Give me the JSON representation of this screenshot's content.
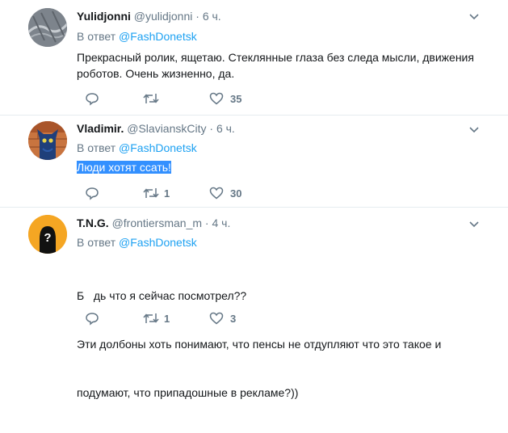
{
  "tweets": [
    {
      "name": "Yulidjonni",
      "handle": "@yulidjonni",
      "separator": "·",
      "time": "6 ч.",
      "reply_prefix": "В ответ",
      "reply_to": "@FashDonetsk",
      "text_lines": [
        "Прекрасный ролик, ящетаю. Стеклянные глаза без следа мысли, движения",
        "роботов. Очень жизненно, да."
      ],
      "retweets": "",
      "likes": "35"
    },
    {
      "name": "Vladimir.",
      "handle": "@SlavianskCity",
      "separator": "·",
      "time": "6 ч.",
      "reply_prefix": "В ответ",
      "reply_to": "@FashDonetsk",
      "text": "Люди хотят ссать!",
      "retweets": "1",
      "likes": "30"
    },
    {
      "name": "T.N.G.",
      "handle": "@frontiersman_m",
      "separator": "·",
      "time": "4 ч.",
      "reply_prefix": "В ответ",
      "reply_to": "@FashDonetsk",
      "text_lines": [
        "Б   дь что я сейчас посмотрел??",
        "Эти долбоны хоть понимают, что пенсы не отдупляют что это такое и",
        "подумают, что припадошные в рекламе?))"
      ],
      "avatar_symbol": "?",
      "retweets": "1",
      "likes": "3"
    }
  ],
  "colors": {
    "accent": "#1da1f2",
    "muted": "#657786",
    "divider": "#e6ecf0",
    "highlight": "#3390ff",
    "avatar3_bg": "#f5a623"
  }
}
